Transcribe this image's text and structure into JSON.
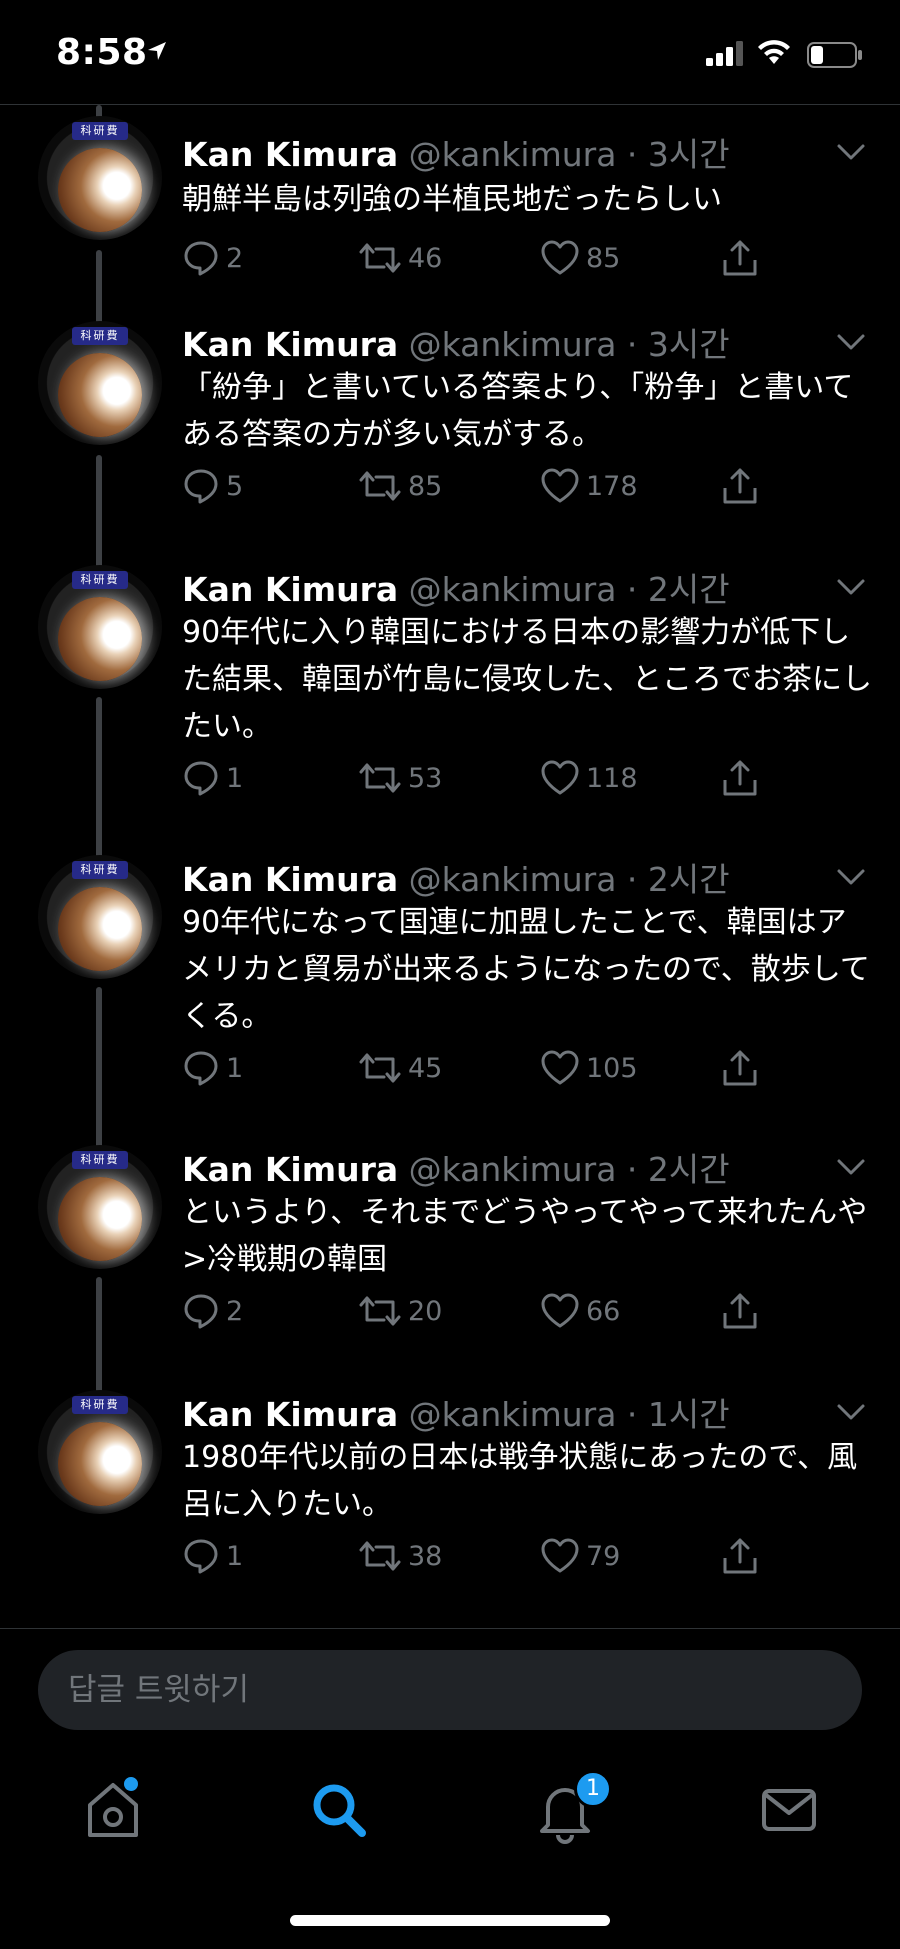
{
  "status_bar": {
    "time": "8:58"
  },
  "tweets": [
    {
      "name": "Kan Kimura",
      "handle": "@kankimura",
      "time": "3시간",
      "text": "朝鮮半島は列強の半植民地だったらしい",
      "replies": "2",
      "retweets": "46",
      "likes": "85"
    },
    {
      "name": "Kan Kimura",
      "handle": "@kankimura",
      "time": "3시간",
      "text": "「紛争」と書いている答案より、「粉争」と書いてある答案の方が多い気がする。",
      "replies": "5",
      "retweets": "85",
      "likes": "178"
    },
    {
      "name": "Kan Kimura",
      "handle": "@kankimura",
      "time": "2시간",
      "text": "90年代に入り韓国における日本の影響力が低下した結果、韓国が竹島に侵攻した、ところでお茶にしたい。",
      "replies": "1",
      "retweets": "53",
      "likes": "118"
    },
    {
      "name": "Kan Kimura",
      "handle": "@kankimura",
      "time": "2시간",
      "text": "90年代になって国連に加盟したことで、韓国はアメリカと貿易が出来るようになったので、散歩してくる。",
      "replies": "1",
      "retweets": "45",
      "likes": "105"
    },
    {
      "name": "Kan Kimura",
      "handle": "@kankimura",
      "time": "2시간",
      "text": "というより、それまでどうやってやって来れたんや>冷戦期の韓国",
      "replies": "2",
      "retweets": "20",
      "likes": "66"
    },
    {
      "name": "Kan Kimura",
      "handle": "@kankimura",
      "time": "1시간",
      "text": "1980年代以前の日本は戦争状態にあったので、風呂に入りたい。",
      "replies": "1",
      "retweets": "38",
      "likes": "79"
    }
  ],
  "avatar_badge": "科研費",
  "reply_field": {
    "placeholder": "답글 트윗하기"
  },
  "tab_bar": {
    "items": [
      "home-icon",
      "search-icon",
      "bell-icon",
      "mail-icon"
    ],
    "active": "search",
    "notification_count": "1"
  },
  "colors": {
    "accent": "#1d9bf0",
    "muted": "#71767b",
    "background": "#000000"
  }
}
